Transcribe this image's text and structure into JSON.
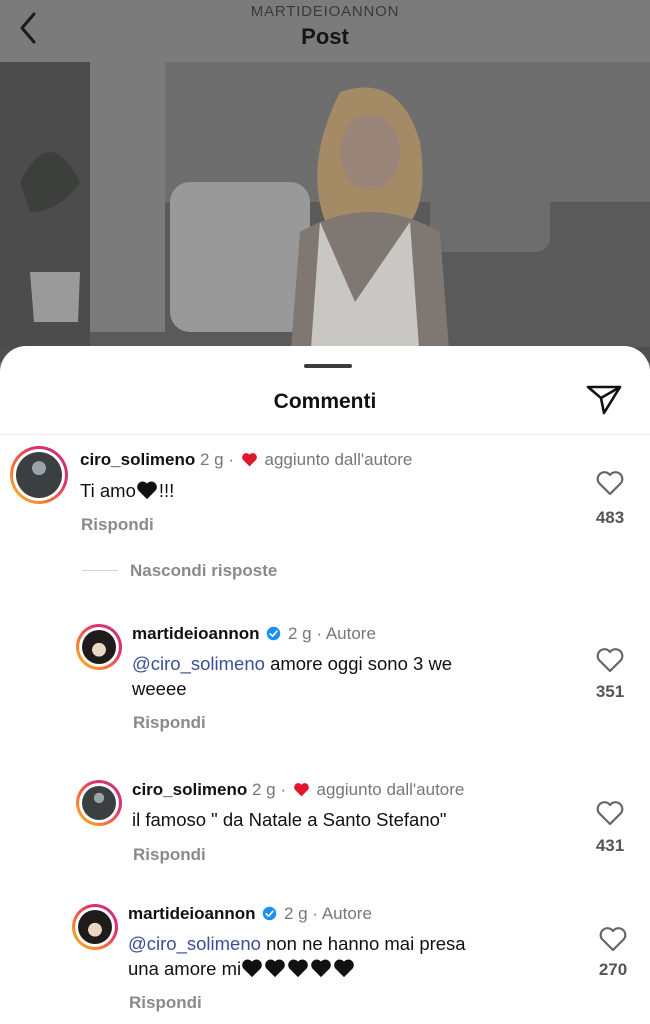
{
  "header": {
    "account": "MARTIDEIOANNON",
    "title": "Post"
  },
  "sheet": {
    "title": "Commenti",
    "hide_replies": "Nascondi risposte"
  },
  "comments": [
    {
      "user": "ciro_solimeno",
      "time": "2 g",
      "sep": "·",
      "badge": "aggiunto dall'autore",
      "text": "Ti amo",
      "hearts": 1,
      "trail": "!!!",
      "reply": "Rispondi",
      "likes": "483"
    },
    {
      "user": "martideioannon",
      "time": "2 g",
      "sep": "·",
      "badge": "Autore",
      "mention": "@ciro_solimeno",
      "text": "amore oggi sono 3 we",
      "text2": "weeee",
      "reply": "Rispondi",
      "likes": "351"
    },
    {
      "user": "ciro_solimeno",
      "time": "2 g",
      "sep": "·",
      "badge": "aggiunto dall'autore",
      "text": "il famoso \" da Natale a Santo Stefano\"",
      "reply": "Rispondi",
      "likes": "431"
    },
    {
      "user": "martideioannon",
      "time": "2 g",
      "sep": "·",
      "badge": "Autore",
      "mention": "@ciro_solimeno",
      "text": "non ne hanno mai presa",
      "text2": "una amore mi",
      "hearts": 5,
      "reply": "Rispondi",
      "likes": "270"
    }
  ],
  "icons": {
    "back": "chevron-left-icon",
    "send": "send-icon",
    "like": "heart-outline-icon",
    "author_like": "red-heart-icon",
    "verified": "verified-badge-icon",
    "emoji": "black-heart-emoji"
  },
  "colors": {
    "mention": "#3b4f95",
    "heart": "#e0162b",
    "verified": "#1d8ff0"
  }
}
